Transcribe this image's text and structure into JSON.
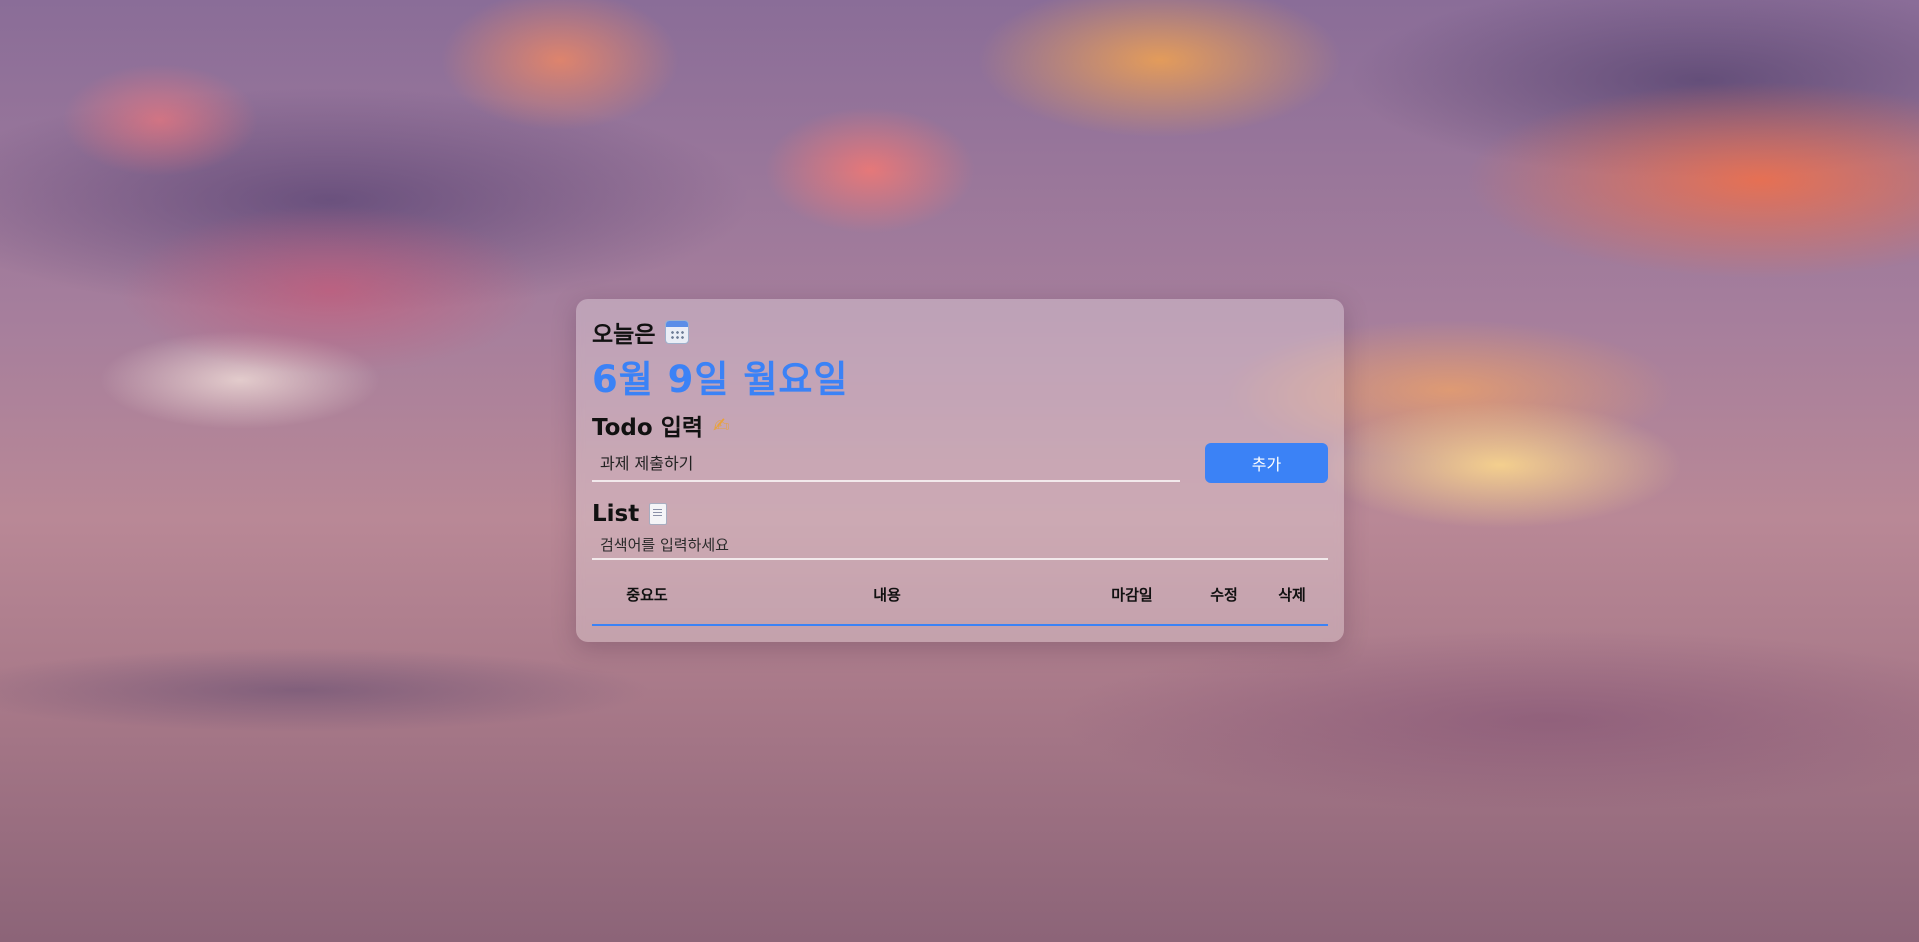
{
  "today": {
    "label": "오늘은",
    "icon": "calendar-icon",
    "date": "6월 9일 월요일"
  },
  "todo": {
    "heading": "Todo 입력",
    "heading_icon": "writing-hand-icon",
    "input_value": "과제 제출하기",
    "add_label": "추가",
    "accent_color": "#3b82f6"
  },
  "list": {
    "heading": "List",
    "heading_icon": "document-icon",
    "search_placeholder": "검색어를 입력하세요",
    "columns": [
      "중요도",
      "내용",
      "마감일",
      "수정",
      "삭제"
    ]
  }
}
